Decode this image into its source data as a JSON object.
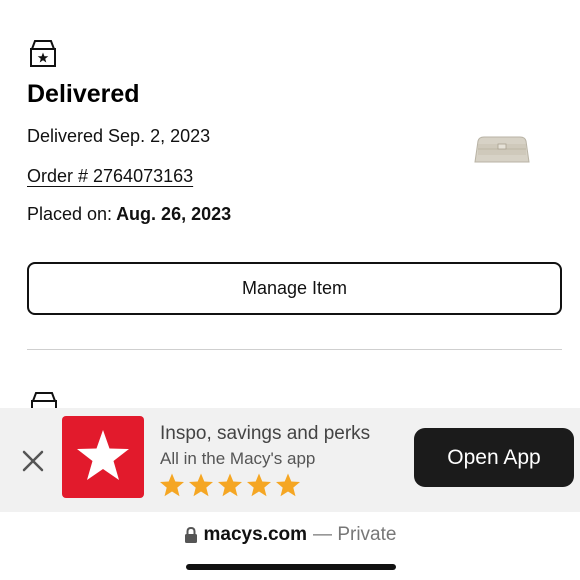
{
  "order": {
    "status_title": "Delivered",
    "delivered_date": "Delivered Sep. 2, 2023",
    "order_number": "Order # 2764073163",
    "placed_label": "Placed on:",
    "placed_date": "Aug. 26, 2023",
    "manage_button": "Manage Item",
    "icons": {
      "status": "delivered-box-icon",
      "next": "box-icon",
      "thumbnail": "handbag-thumbnail"
    }
  },
  "app_banner": {
    "title": "Inspo, savings and perks",
    "subtitle": "All in the Macy's app",
    "rating_stars": 5,
    "open_button": "Open App",
    "brand_color": "#e21a2c",
    "star_color": "#f5a623"
  },
  "browser": {
    "domain": "macys.com",
    "mode": "— Private"
  }
}
